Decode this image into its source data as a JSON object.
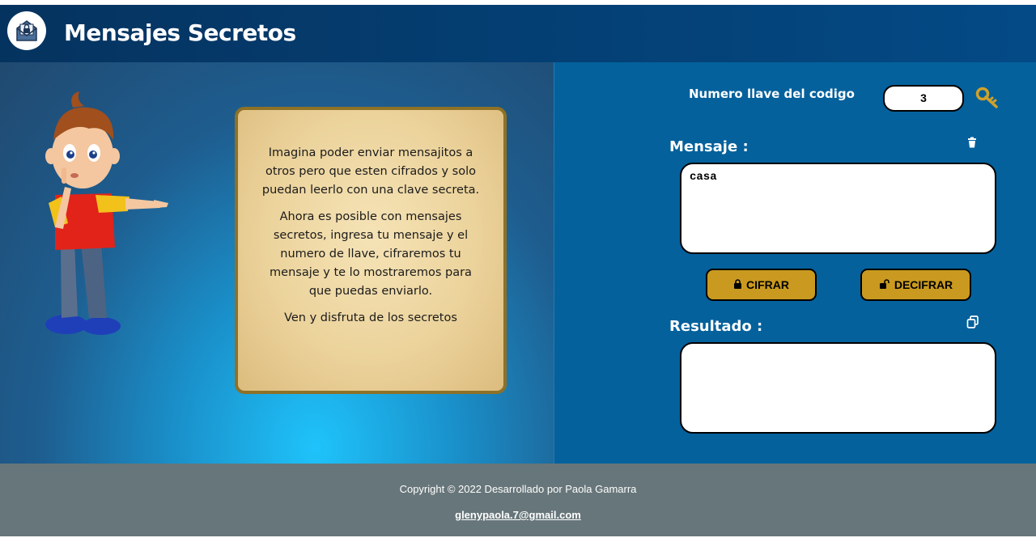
{
  "header": {
    "title": "Mensajes Secretos",
    "logo_icon": "envelope-lock-icon"
  },
  "info": {
    "paragraphs": [
      "Imagina poder enviar mensajitos a otros pero que esten cifrados y solo puedan leerlo con una clave secreta.",
      "Ahora es posible con mensajes secretos, ingresa tu mensaje y el numero de llave, cifraremos tu mensaje y te lo mostraremos para que puedas enviarlo.",
      "Ven y disfruta de los secretos"
    ]
  },
  "form": {
    "key_label": "Numero llave del codigo",
    "key_value": "3",
    "key_icon": "key-icon",
    "message_label": "Mensaje :",
    "message_value": "casa",
    "clear_icon": "trash-icon",
    "cipher_button": "CIFRAR",
    "cipher_icon": "lock-icon",
    "decipher_button": "DECIFRAR",
    "decipher_icon": "unlock-icon",
    "result_label": "Resultado :",
    "result_value": "",
    "copy_icon": "copy-icon"
  },
  "footer": {
    "copyright": "Copyright © 2022 Desarrollado por Paola Gamarra",
    "email": "glenypaola.7@gmail.com"
  },
  "colors": {
    "header_bg": "#05335f",
    "panel_right": "#04619c",
    "button_gold": "#c99a1f",
    "card_border": "#8d7127",
    "footer_bg": "#67767a"
  }
}
